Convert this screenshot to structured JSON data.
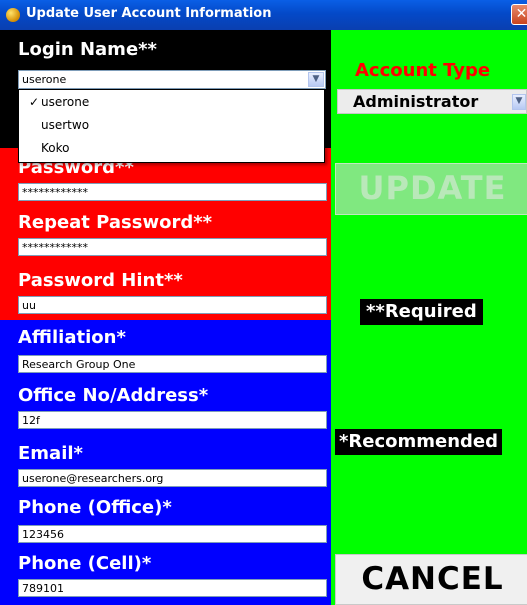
{
  "window": {
    "title": "Update User Account Information",
    "close_glyph": "✕"
  },
  "login": {
    "label": "Login Name**",
    "selected": "userone",
    "options": [
      "userone",
      "usertwo",
      "Koko"
    ],
    "check_glyph": "✓"
  },
  "password": {
    "label": "Password**",
    "value": "************"
  },
  "repeat_password": {
    "label": "Repeat Password**",
    "value": "************"
  },
  "password_hint": {
    "label": "Password Hint**",
    "value": "uu"
  },
  "affiliation": {
    "label": "Affiliation*",
    "value": "Research Group One"
  },
  "office": {
    "label": "Office No/Address*",
    "value": "12f"
  },
  "email": {
    "label": "Email*",
    "value": "userone@researchers.org"
  },
  "phone_office": {
    "label": "Phone (Office)*",
    "value": "123456"
  },
  "phone_cell": {
    "label": "Phone (Cell)*",
    "value": "789101"
  },
  "account_type": {
    "label": "Account Type",
    "selected": "Administrator"
  },
  "buttons": {
    "update": "UPDATE",
    "cancel": "CANCEL"
  },
  "notes": {
    "required": "**Required",
    "recommended": "*Recommended"
  },
  "icons": {
    "app": "app-globe-icon",
    "dropdown": "chevron-down-icon",
    "close": "close-icon",
    "check": "checkmark-icon"
  },
  "colors": {
    "black_panel": "#000000",
    "red_panel": "#ff0000",
    "blue_panel": "#0000ff",
    "green_panel": "#00ff00",
    "account_type_label": "#ff0000"
  }
}
